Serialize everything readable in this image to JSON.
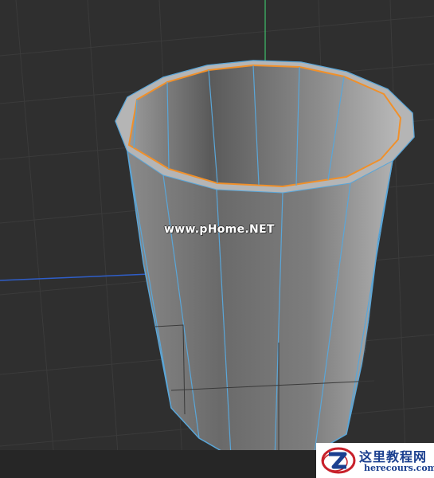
{
  "viewport": {
    "background": "#2f2f2f",
    "grid_color": "#3b3b3b",
    "x_axis_color": "#2f5ec9",
    "y_axis_color": "#3fbf6a"
  },
  "model": {
    "name": "cup",
    "body_color": "#7f7f7f",
    "edge_color": "#5aa6d8",
    "selected_edge_color": "#f0902a",
    "icon": "cylinder-cup-icon"
  },
  "watermark": {
    "text": "www.pHome.NET"
  },
  "site_logo": {
    "title": "这里教程网",
    "url": "herecours.com",
    "accent_color": "#c8202a",
    "text_color": "#1b3f8f"
  }
}
